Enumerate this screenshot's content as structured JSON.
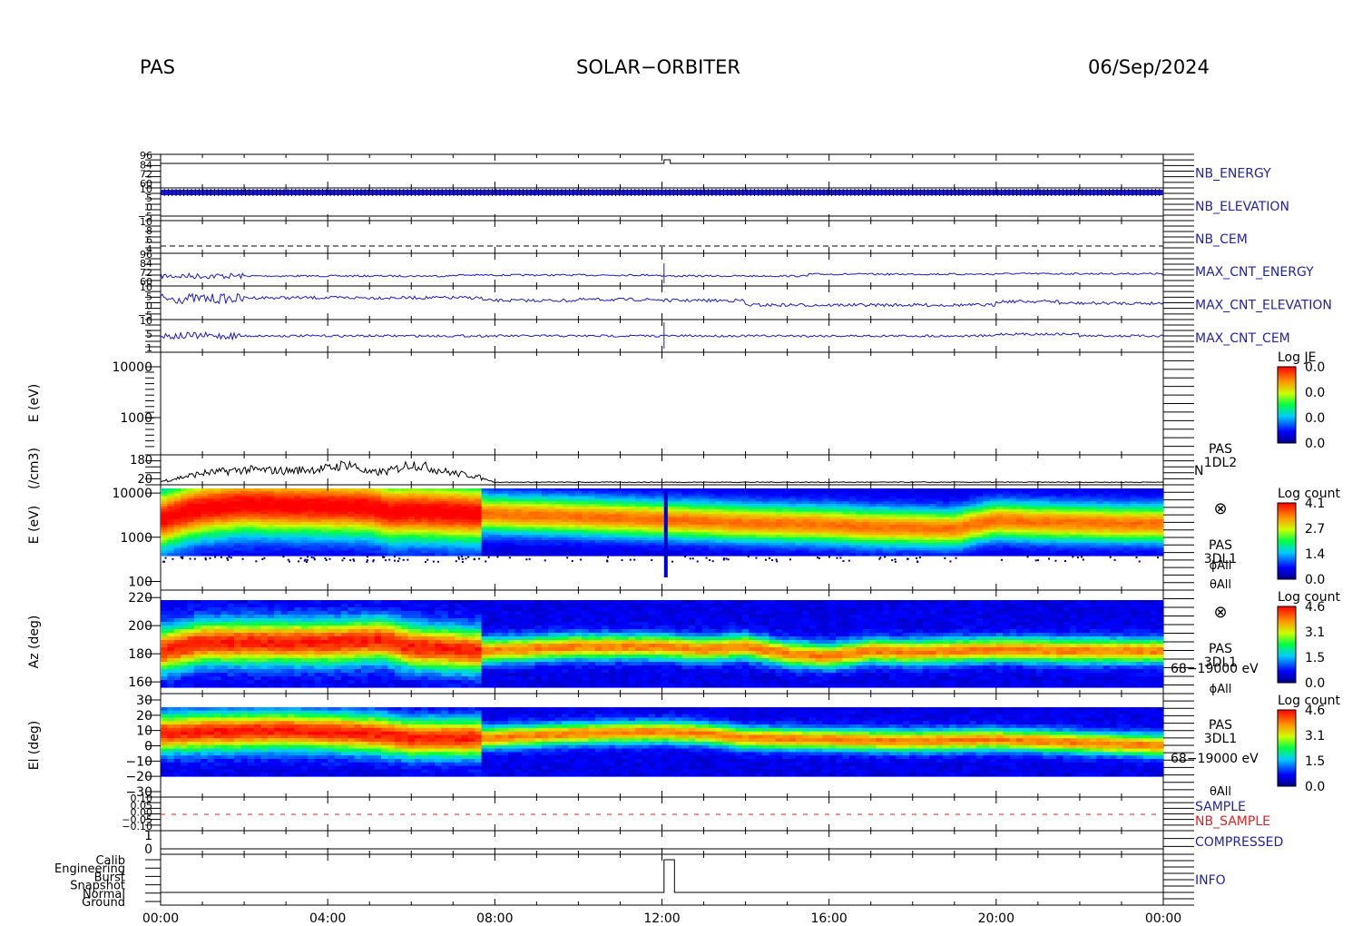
{
  "header": {
    "instrument": "PAS",
    "mission": "SOLAR−ORBITER",
    "date": "06/Sep/2024"
  },
  "time_axis": {
    "ticks": [
      "00:00",
      "04:00",
      "08:00",
      "12:00",
      "16:00",
      "20:00",
      "00:00"
    ]
  },
  "panels": {
    "nb_energy": {
      "label": "NB_ENERGY",
      "ticks": [
        "96",
        "84",
        "72",
        "60"
      ]
    },
    "nb_elevation": {
      "label": "NB_ELEVATION",
      "ticks": [
        "10",
        "5",
        "0",
        "−5"
      ]
    },
    "nb_cem": {
      "label": "NB_CEM",
      "ticks": [
        "10",
        "8",
        "6",
        "4"
      ]
    },
    "max_cnt_energy": {
      "label": "MAX_CNT_ENERGY",
      "ticks": [
        "96",
        "84",
        "72",
        "60"
      ]
    },
    "max_cnt_elevation": {
      "label": "MAX_CNT_ELEVATION",
      "ticks": [
        "10",
        "5",
        "0",
        "−5"
      ]
    },
    "max_cnt_cem": {
      "label": "MAX_CNT_CEM",
      "ticks": [
        "10",
        "5",
        "1"
      ]
    },
    "je": {
      "ylabel": "E (eV)",
      "yticks": [
        "10000",
        "1000"
      ],
      "cbar_title": "Log JE",
      "cbar_ticks": [
        "0.0",
        "0.0",
        "0.0",
        "0.0"
      ]
    },
    "density": {
      "ylabel": "(/cm3)",
      "yticks": [
        "180",
        "20"
      ],
      "tag_line1": "PAS",
      "tag_line2": "1DL2",
      "series": "N"
    },
    "energy_spec": {
      "ylabel": "E (eV)",
      "yticks": [
        "10000",
        "1000",
        "100"
      ],
      "cbar_title": "Log count",
      "cbar_ticks": [
        "4.1",
        "2.7",
        "1.4",
        "0.0"
      ],
      "symbol": "⊗",
      "tag_line1": "PAS",
      "tag_line2": "3DL1",
      "phi": "ϕAll",
      "theta": "θAll"
    },
    "azimuth_spec": {
      "ylabel": "Az (deg)",
      "yticks": [
        "220",
        "200",
        "180",
        "160"
      ],
      "cbar_title": "Log count",
      "cbar_ticks": [
        "4.6",
        "3.1",
        "1.5",
        "0.0"
      ],
      "symbol": "⊗",
      "tag_line1": "PAS",
      "tag_line2": "3DL1",
      "range": "68−19000 eV",
      "phi": "ϕAll"
    },
    "elevation_spec": {
      "ylabel": "El (deg)",
      "yticks": [
        "30",
        "20",
        "10",
        "0",
        "−10",
        "−20",
        "−30"
      ],
      "cbar_title": "Log count",
      "cbar_ticks": [
        "4.6",
        "3.1",
        "1.5",
        "0.0"
      ],
      "tag_line1": "PAS",
      "tag_line2": "3DL1",
      "range": "68−19000 eV",
      "theta": "θAll"
    },
    "sample": {
      "label": "SAMPLE",
      "label2": "NB_SAMPLE",
      "ticks": [
        "0.10",
        "0.05",
        "0.00",
        "−0.05",
        "−0.10"
      ]
    },
    "compressed": {
      "label": "COMPRESSED",
      "ticks": [
        "1",
        "0"
      ]
    },
    "info": {
      "label": "INFO",
      "ticks": [
        "Calib",
        "Engineering",
        "Burst",
        "Snapshot",
        "Normal",
        "Ground"
      ]
    }
  },
  "colors": {
    "panel_label": "#2222aa",
    "sample_red": "#dd2222",
    "trace_blue": "#1a1acc",
    "spectrogram_bg": "#00008a"
  },
  "chart_data": {
    "type": "heatmap",
    "x_range_hours": [
      0,
      24
    ],
    "energy_peak_ev": {
      "x": [
        0,
        1,
        2,
        3,
        4,
        5,
        5.5,
        6,
        7,
        8,
        9,
        10,
        11,
        12,
        13,
        14,
        15,
        16,
        17,
        18,
        19,
        20,
        21,
        22,
        23,
        24
      ],
      "y": [
        2500,
        4500,
        5500,
        5200,
        5000,
        4800,
        3700,
        3900,
        3600,
        3300,
        3100,
        2900,
        2700,
        2500,
        2300,
        2100,
        2000,
        1900,
        1700,
        1650,
        1550,
        2400,
        2200,
        2100,
        2000,
        2000
      ]
    },
    "density_cm3": {
      "x": [
        0,
        1,
        2,
        3,
        4,
        4.5,
        5,
        5.5,
        6,
        7,
        7.5,
        8,
        10,
        12,
        14,
        16,
        18,
        20,
        22,
        24
      ],
      "y": [
        25,
        60,
        75,
        70,
        80,
        100,
        60,
        70,
        100,
        60,
        50,
        22,
        22,
        22,
        22,
        22,
        22,
        22,
        22,
        22
      ]
    },
    "azimuth_peak_deg": {
      "x": [
        0,
        1,
        4,
        5.3,
        6,
        7.7,
        10,
        12,
        13,
        14,
        15,
        16,
        17,
        18,
        20,
        22,
        24
      ],
      "y": [
        182,
        188,
        188,
        190,
        185,
        182,
        185,
        185,
        183,
        185,
        180,
        178,
        182,
        181,
        183,
        182,
        182
      ]
    },
    "elevation_peak_deg": {
      "x": [
        0,
        1,
        3,
        5,
        6,
        7.7,
        10,
        12,
        13,
        14,
        16,
        18,
        20,
        22,
        24
      ],
      "y": [
        8,
        9,
        10,
        8,
        5,
        5,
        8,
        9,
        8,
        5,
        4,
        3,
        4,
        2,
        0
      ]
    }
  }
}
